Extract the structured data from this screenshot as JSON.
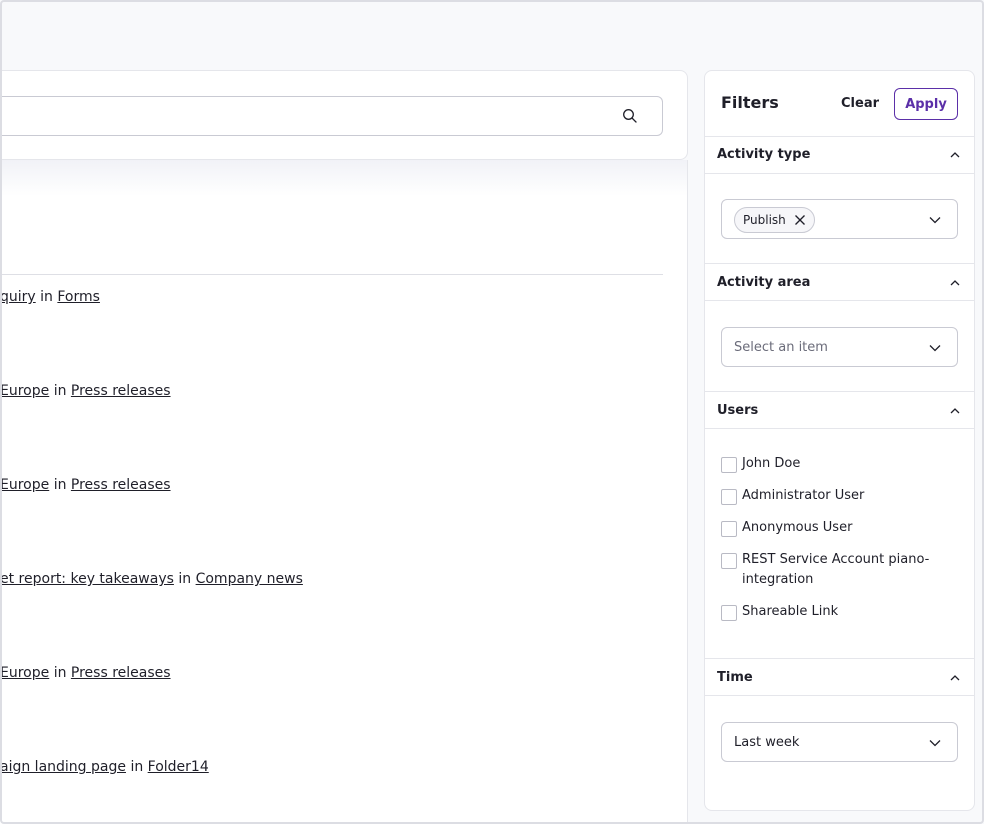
{
  "search": {
    "value": "",
    "placeholder": ""
  },
  "activity_list": [
    {
      "item": "quiry",
      "separator": "in",
      "location": "Forms"
    },
    {
      "item": "Europe",
      "separator": "in",
      "location": "Press releases"
    },
    {
      "item": "Europe",
      "separator": "in",
      "location": "Press releases"
    },
    {
      "item": "et report: key takeaways",
      "separator": "in",
      "location": "Company news"
    },
    {
      "item": "Europe",
      "separator": "in",
      "location": "Press releases"
    },
    {
      "item": "aign landing page",
      "separator": "in",
      "location": "Folder14"
    }
  ],
  "filters": {
    "title": "Filters",
    "clear_label": "Clear",
    "apply_label": "Apply",
    "activity_type": {
      "title": "Activity type",
      "chip": "Publish"
    },
    "activity_area": {
      "title": "Activity area",
      "placeholder": "Select an item"
    },
    "users": {
      "title": "Users",
      "items": [
        "John Doe",
        "Administrator User",
        "Anonymous User",
        "REST Service Account piano-integration",
        "Shareable Link"
      ]
    },
    "time": {
      "title": "Time",
      "value": "Last week"
    }
  },
  "colors": {
    "accent": "#5b2fa8",
    "border": "#c9cad3",
    "text": "#1f1f29"
  }
}
